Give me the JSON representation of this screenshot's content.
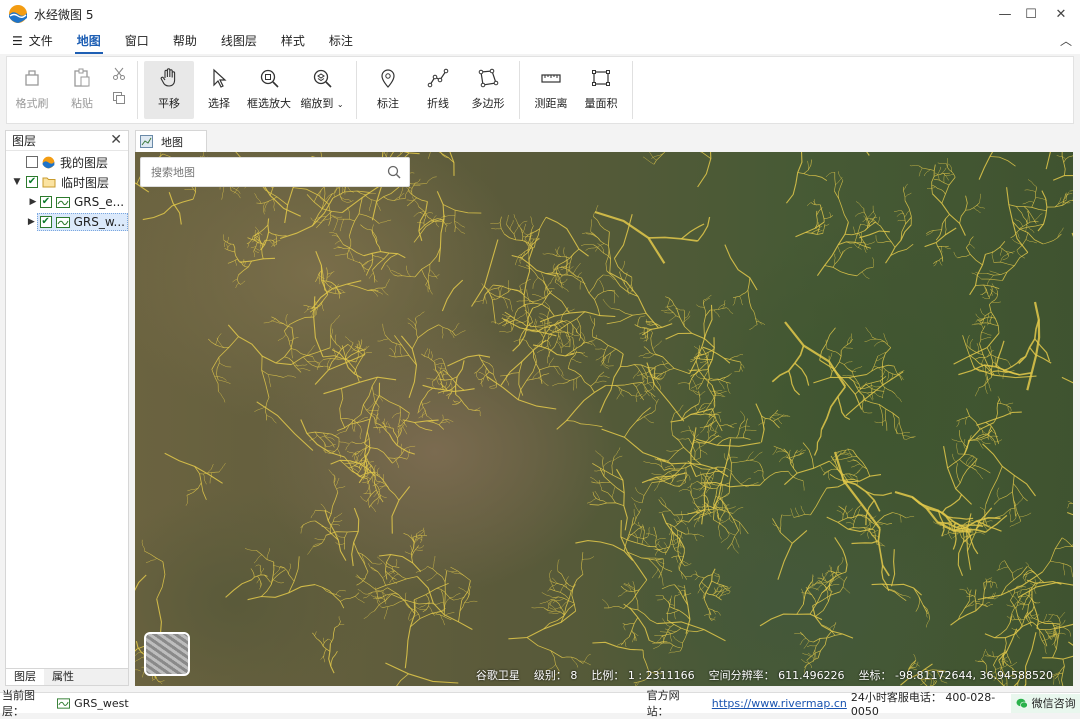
{
  "window": {
    "title": "水经微图 5"
  },
  "menu": {
    "hamburger": "☰",
    "items": [
      "文件",
      "地图",
      "窗口",
      "帮助",
      "线图层",
      "样式",
      "标注"
    ],
    "active": "地图"
  },
  "ribbon": {
    "format_brush": "格式刷",
    "paste": "粘贴",
    "pan": "平移",
    "select": "选择",
    "box_zoom": "框选放大",
    "zoom_to": "缩放到",
    "mark": "标注",
    "polyline": "折线",
    "polygon": "多边形",
    "measure_distance": "测距离",
    "measure_area": "量面积"
  },
  "layers_panel": {
    "title": "图层",
    "my_layers": "我的图层",
    "temp_layers": "临时图层",
    "layer1": "GRS_e...",
    "layer2": "GRS_w..."
  },
  "panel_tabs": {
    "layers": "图层",
    "properties": "属性"
  },
  "doc_tab": {
    "label": "地图"
  },
  "search": {
    "placeholder": "搜索地图"
  },
  "map_status": {
    "source": "谷歌卫星",
    "level": "级别： 8",
    "scale": "比例： 1 : 2311166",
    "resolution": "空间分辨率： 611.496226",
    "coords": "坐标： -98.81172644, 36.94588520"
  },
  "statusbar": {
    "current_layer_label": "当前图层：",
    "current_layer": "GRS_west",
    "site_label": "官方网站：",
    "site_url": "https://www.rivermap.cn",
    "hotline": "24小时客服电话： 400-028-0050",
    "consult": "微信咨询"
  },
  "colors": {
    "accent": "#1e5fb4",
    "river": "#e3c94a"
  }
}
